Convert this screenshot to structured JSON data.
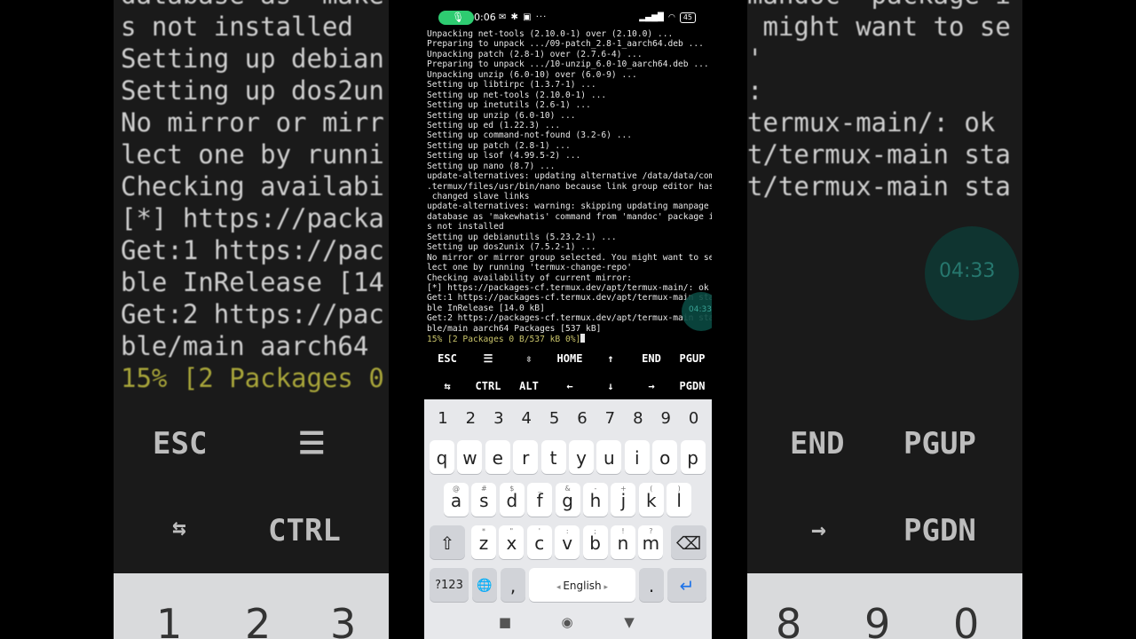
{
  "status_bar": {
    "time": "0:06",
    "left_icons": "✉ ✱ ▣ ···",
    "signal": "▂▄▆█",
    "wifi": "◠",
    "battery": "45"
  },
  "terminal": {
    "lines": [
      "Unpacking net-tools (2.10.0-1) over (2.10.0) ...",
      "Preparing to unpack .../09-patch_2.8-1_aarch64.deb ...",
      "Unpacking patch (2.8-1) over (2.7.6-4) ...",
      "Preparing to unpack .../10-unzip_6.0-10_aarch64.deb ...",
      "Unpacking unzip (6.0-10) over (6.0-9) ...",
      "Setting up libtirpc (1.3.7-1) ...",
      "Setting up net-tools (2.10.0-1) ...",
      "Setting up inetutils (2.6-1) ...",
      "Setting up unzip (6.0-10) ...",
      "Setting up ed (1.22.3) ...",
      "Setting up command-not-found (3.2-6) ...",
      "Setting up patch (2.8-1) ...",
      "Setting up lsof (4.99.5-2) ...",
      "Setting up nano (8.7) ...",
      "update-alternatives: updating alternative /data/data/com",
      ".termux/files/usr/bin/nano because link group editor has",
      " changed slave links",
      "update-alternatives: warning: skipping updating manpage",
      "database as 'makewhatis' command from 'mandoc' package i",
      "s not installed",
      "Setting up debianutils (5.23.2-1) ...",
      "Setting up dos2unix (7.5.2-1) ...",
      "No mirror or mirror group selected. You might want to se",
      "lect one by running 'termux-change-repo'",
      "Checking availability of current mirror:",
      "[*] https://packages-cf.termux.dev/apt/termux-main/: ok",
      "Get:1 https://packages-cf.termux.dev/apt/termux-main sta",
      "ble InRelease [14.0 kB]",
      "Get:2 https://packages-cf.termux.dev/apt/termux-main sta",
      "ble/main aarch64 Packages [537 kB]"
    ],
    "progress_line": "15% [2 Packages 0 B/537 kB 0%]"
  },
  "clock_overlay": "04:33",
  "extra_keys": {
    "row1": [
      "ESC",
      "☰",
      "⇳",
      "HOME",
      "↑",
      "END",
      "PGUP"
    ],
    "row2": [
      "⇆",
      "CTRL",
      "ALT",
      "←",
      "↓",
      "→",
      "PGDN"
    ]
  },
  "keyboard": {
    "numbers": [
      "1",
      "2",
      "3",
      "4",
      "5",
      "6",
      "7",
      "8",
      "9",
      "0"
    ],
    "row1": [
      "q",
      "w",
      "e",
      "r",
      "t",
      "y",
      "u",
      "i",
      "o",
      "p"
    ],
    "row2": [
      "a",
      "s",
      "d",
      "f",
      "g",
      "h",
      "j",
      "k",
      "l"
    ],
    "row2_hints": [
      "@",
      "#",
      "$",
      "_",
      "&",
      "-",
      "+",
      "(",
      ")"
    ],
    "row3": [
      "z",
      "x",
      "c",
      "v",
      "b",
      "n",
      "m"
    ],
    "row3_hints": [
      "*",
      "\"",
      "'",
      ":",
      ";",
      "!",
      "?"
    ],
    "symbols_label": "?123",
    "comma": ",",
    "space_label": "English",
    "period": ".",
    "enter": "↵",
    "shift": "⇧",
    "backspace": "⌫",
    "globe": "🌐"
  },
  "background": {
    "left_lines": [
      "database as 'make",
      "s not installed",
      "Setting up debian",
      "Setting up dos2un",
      "No mirror or mirr",
      "lect one by runni",
      "Checking availabi",
      "[*] https://packa",
      "Get:1 https://pac",
      "ble InRelease [14",
      "Get:2 https://pac",
      "ble/main aarch64 "
    ],
    "left_green": "15% [2 Packages 0",
    "left_keys": [
      "ESC",
      "☰",
      "⇆",
      "CTRL"
    ],
    "left_digits": [
      "1",
      "2",
      "3"
    ],
    "right_lines": [
      "mandoc' package i",
      "",
      "",
      " might want to se",
      "'",
      ":",
      "termux-main/: ok",
      "t/termux-main sta",
      "",
      "t/termux-main sta"
    ],
    "right_keys": [
      "END",
      "PGUP",
      "→",
      "PGDN"
    ],
    "right_digits": [
      "8",
      "9",
      "0"
    ],
    "right_clock": "04:33"
  }
}
